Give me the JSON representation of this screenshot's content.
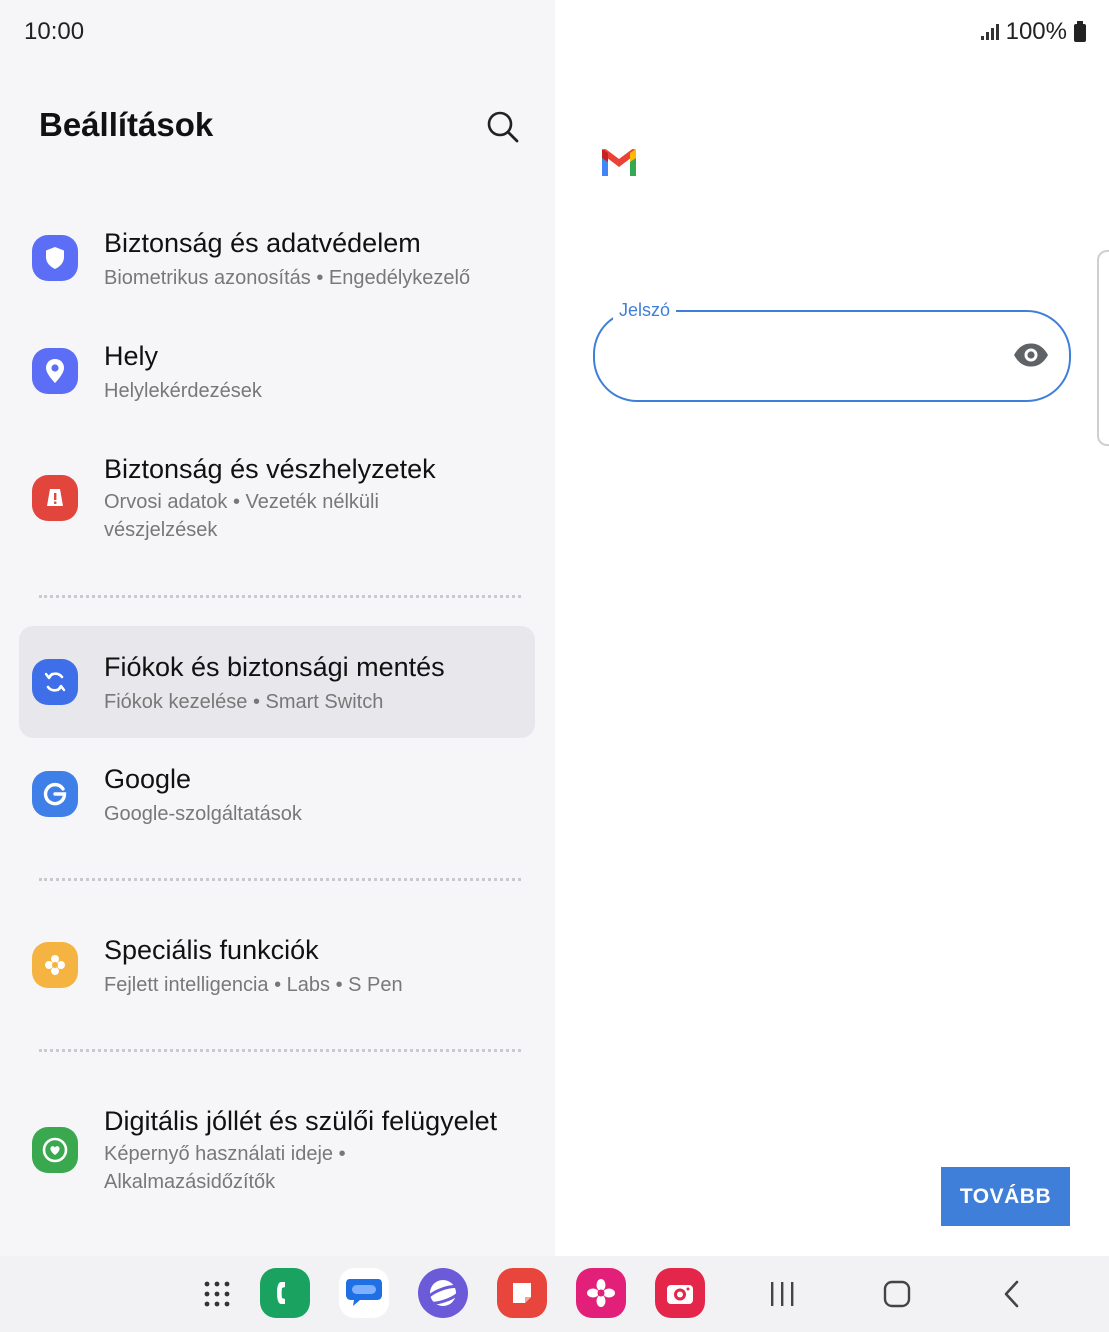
{
  "status_bar": {
    "time": "10:00",
    "battery": "100%"
  },
  "settings": {
    "title": "Beállítások",
    "items": [
      {
        "title": "Biztonság és adatvédelem",
        "subtitle": "Biometrikus azonosítás  •  Engedélykezelő",
        "icon": "shield-icon",
        "color": "#5b6ef5"
      },
      {
        "title": "Hely",
        "subtitle": "Helylekérdezések",
        "icon": "location-pin-icon",
        "color": "#5b6ef5"
      },
      {
        "title": "Biztonság és vészhelyzetek",
        "subtitle": "Orvosi adatok  •  Vezeték nélküli vészjelzések",
        "icon": "emergency-icon",
        "color": "#e2453c"
      },
      {
        "title": "Fiókok és biztonsági mentés",
        "subtitle": "Fiókok kezelése  •  Smart Switch",
        "icon": "sync-icon",
        "color": "#3f6fe8"
      },
      {
        "title": "Google",
        "subtitle": "Google-szolgáltatások",
        "icon": "google-icon",
        "color": "#3f7fe8"
      },
      {
        "title": "Speciális funkciók",
        "subtitle": "Fejlett intelligencia  •  Labs  •  S Pen",
        "icon": "advanced-features-icon",
        "color": "#f5b342"
      },
      {
        "title": "Digitális jóllét és szülői felügyelet",
        "subtitle": "Képernyő használati ideje  •  Alkalmazásidőzítők",
        "icon": "wellbeing-icon",
        "color": "#3aa84f"
      }
    ]
  },
  "login": {
    "password_label": "Jelszó",
    "password_value": "",
    "next_button": "TOVÁBB"
  },
  "colors": {
    "accent": "#3f7fd9",
    "panel_bg": "#f6f6f8"
  }
}
